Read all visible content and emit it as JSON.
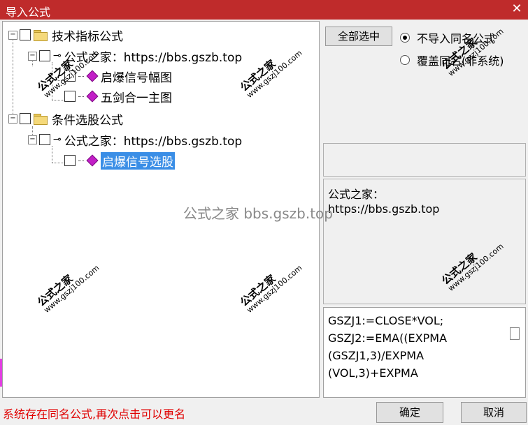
{
  "window": {
    "title": "导入公式",
    "close_glyph": "✕"
  },
  "tree": {
    "nodes": [
      {
        "label": "技术指标公式"
      },
      {
        "label": "公式之家：https://bbs.gszb.top"
      },
      {
        "label": "启爆信号幅图"
      },
      {
        "label": "五剑合一主图"
      },
      {
        "label": "条件选股公式"
      },
      {
        "label": "公式之家：https://bbs.gszb.top"
      },
      {
        "label": "启爆信号选股"
      }
    ]
  },
  "options": {
    "select_all_label": "全部选中",
    "radio_no_import": "不导入同名公式",
    "radio_overwrite": "覆盖同名(非系统)",
    "selected": "不导入同名公式"
  },
  "info": {
    "line1": "公式之家：",
    "line2": "https://bbs.gszb.top"
  },
  "code": {
    "lines": [
      "GSZJ1:=CLOSE*VOL;",
      "GSZJ2:=EMA((EXPMA",
      "(GSZJ1,3)/EXPMA",
      "(VOL,3)+EXPMA"
    ]
  },
  "status": {
    "message": "系统存在同名公式,再次点击可以更名"
  },
  "buttons": {
    "ok": "确定",
    "cancel": "取消"
  },
  "watermark": {
    "brand": "公式之家",
    "site": "www.gszj100.com",
    "center": "公式之家 bbs.gszb.top"
  },
  "colors": {
    "titlebar": "#bf2b2b",
    "selection": "#3a8ee6",
    "status_text": "#e00000",
    "gem": "#c21ec7"
  }
}
